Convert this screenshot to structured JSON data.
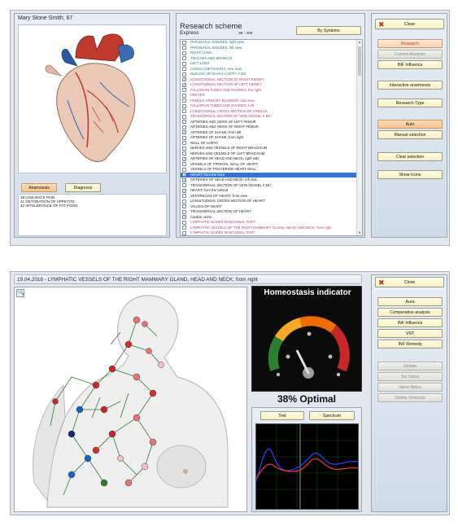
{
  "top": {
    "patient": "Mary Stone Smith, 67",
    "tabs": [
      "Anamnesis",
      "Diagnosis"
    ],
    "notes": [
      "28 LOW BACK PAIN",
      "41 DETORATION OF APPETITE.",
      "42 INTOLERANCE OF FAT FOOD."
    ],
    "research_title": "Research scheme",
    "mode": "Express",
    "counter": "39 : 209",
    "by_systems": "By Systems",
    "items": [
      {
        "label": "PARANASAL SINUSES; right view",
        "color": "#1e7a6e",
        "checked": false,
        "selected": false
      },
      {
        "label": "PARANASAL SINUSES; left view",
        "color": "#1e7a6e",
        "checked": false,
        "selected": false
      },
      {
        "label": "RIGHT LUNG",
        "color": "#1e7a6e",
        "checked": false,
        "selected": false
      },
      {
        "label": "TRACHEA AND BRONCHI",
        "color": "#1e7a6e",
        "checked": false,
        "selected": false
      },
      {
        "label": "LEFT LUNG",
        "color": "#1e7a6e",
        "checked": false,
        "selected": false
      },
      {
        "label": "LUNGS AND PLEURA; rear view",
        "color": "#1e7a6e",
        "checked": false,
        "selected": false
      },
      {
        "label": "MUCOSA OF NASAL CAVITY # MC",
        "color": "#1e7a6e",
        "checked": false,
        "selected": false
      },
      {
        "label": "LONGITUDINAL SECTION OF RIGHT KIDNEY",
        "color": "#b0406a",
        "checked": true,
        "selected": false
      },
      {
        "label": "LONGITUDINAL SECTION OF LEFT KIDNEY",
        "color": "#b0406a",
        "checked": true,
        "selected": false
      },
      {
        "label": "FALLOPIAN TUBES AND OVARIES, the right",
        "color": "#b0406a",
        "checked": false,
        "selected": false
      },
      {
        "label": "URETER",
        "color": "#b0406a",
        "checked": false,
        "selected": false
      },
      {
        "label": "FEMALE URINARY BLADDER; rear view",
        "color": "#b0406a",
        "checked": false,
        "selected": false
      },
      {
        "label": "FALLOPIAN TUBES AND OVARIES; Left",
        "color": "#b0406a",
        "checked": false,
        "selected": false
      },
      {
        "label": "LONGITUDINAL CROSS-SECTION OF UTERUS",
        "color": "#b0406a",
        "checked": false,
        "selected": false
      },
      {
        "label": "TRANSVERSAL SECTION OF VEIN VESSEL # MC",
        "color": "#b0406a",
        "checked": false,
        "selected": false
      },
      {
        "label": "ARTERIES AND VEINS OF LEFT FEMUR",
        "color": "#222222",
        "checked": false,
        "selected": false
      },
      {
        "label": "ARTERIES AND VEINS OF RIGHT FEMUR",
        "color": "#222222",
        "checked": false,
        "selected": false
      },
      {
        "label": "ARTERIES OF SHANK; from left",
        "color": "#222222",
        "checked": true,
        "selected": false
      },
      {
        "label": "ARTERIES OF SHANK; from right",
        "color": "#222222",
        "checked": false,
        "selected": false
      },
      {
        "label": "WALL OF AORTA",
        "color": "#222222",
        "checked": false,
        "selected": false
      },
      {
        "label": "NERVES AND VESSELS OF RIGHT BRACHIUM",
        "color": "#222222",
        "checked": false,
        "selected": false
      },
      {
        "label": "NERVES AND VESSELS OF LEFT BRACHIUM",
        "color": "#222222",
        "checked": false,
        "selected": false
      },
      {
        "label": "ARTERIES OF HEAD AND NECK; right side",
        "color": "#222222",
        "checked": true,
        "selected": false
      },
      {
        "label": "VESSELS OF FRONTAL WALL OF HEART",
        "color": "#222222",
        "checked": false,
        "selected": false
      },
      {
        "label": "VESSELS OF POSTERIOR HEART WALL",
        "color": "#222222",
        "checked": false,
        "selected": false
      },
      {
        "label": "HEART; from the front",
        "color": "#ffffff",
        "checked": true,
        "selected": true
      },
      {
        "label": "ARTERIES OF HEAD AND NECK; left side",
        "color": "#222222",
        "checked": true,
        "selected": false
      },
      {
        "label": "TRANSVERSAL SECTION OF VEIN VESSEL # MC",
        "color": "#222222",
        "checked": false,
        "selected": false
      },
      {
        "label": "HEART; from the behind",
        "color": "#222222",
        "checked": true,
        "selected": false
      },
      {
        "label": "VENTRICLES OF HEART, front view",
        "color": "#222222",
        "checked": false,
        "selected": false
      },
      {
        "label": "LONGITUDINAL CROSS-SECTION OF HEART",
        "color": "#222222",
        "checked": false,
        "selected": false
      },
      {
        "label": "VALVES OF HEART",
        "color": "#222222",
        "checked": false,
        "selected": false
      },
      {
        "label": "TRANSVERSAL SECTION OF HEART",
        "color": "#222222",
        "checked": false,
        "selected": false
      },
      {
        "label": "Cardiac veins",
        "color": "#222222",
        "checked": true,
        "selected": false
      },
      {
        "label": "LYMPHATIC NODES IN INGUINAL PART",
        "color": "#b0406a",
        "checked": false,
        "selected": false
      },
      {
        "label": "LYMPHATIC VESSELS OF THE RIGHT MAMMARY GLAND, HEAD AND NECK; from right",
        "color": "#b0406a",
        "checked": false,
        "selected": false
      },
      {
        "label": "LYMPHATIC NODES IN INGUINAL PART",
        "color": "#b0406a",
        "checked": false,
        "selected": false
      }
    ],
    "buttons": {
      "close": "Close",
      "research": "Research",
      "current_analysis": "Current Analysis",
      "inf_influence": "INF Influence",
      "interactive_anamnesis": "Interactive anamnesis",
      "research_type": "Research Type",
      "auto": "Auto",
      "manual_selection": "Manual selection",
      "clear_selection": "Clear selection",
      "show_icons": "Show Icons"
    }
  },
  "bottom": {
    "title": "19.04.2016 - LYMPHATIC VESSELS OF THE RIGHT MAMMARY GLAND, HEAD AND NECK; from right",
    "homeostasis_title": "Homeostasis indicator",
    "optimal_value": 38,
    "optimal_text": "38% Optimal",
    "test_tab": "Test",
    "spectrum_tab": "Spectrum",
    "buttons": {
      "close": "Close",
      "aura": "Aura",
      "comparative_analysis": "Comperative analysis",
      "inf_influence": "INF Influence",
      "vrt": "VRT",
      "inf_remedy": "INF Remedy",
      "update": "Update",
      "set_nidus": "Set Nidus",
      "value_nidus": "Value Nidus",
      "delete_selected": "Delete Selected"
    }
  }
}
